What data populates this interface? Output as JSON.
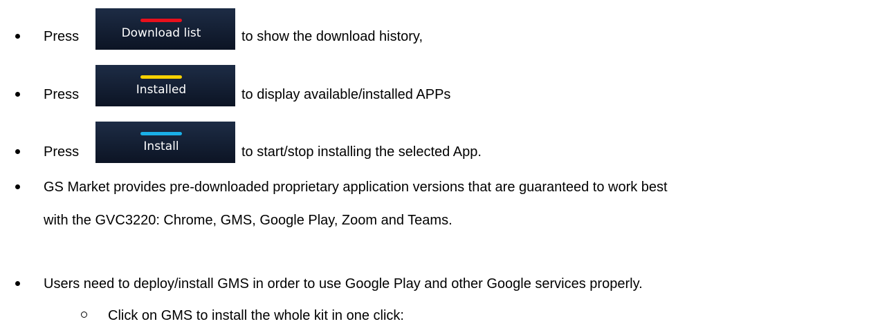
{
  "items": [
    {
      "pre": "Press",
      "button": {
        "label": "Download list",
        "accent": "#e8101c"
      },
      "post": "to show the download history,"
    },
    {
      "pre": "Press",
      "button": {
        "label": "Installed",
        "accent": "#f5d000"
      },
      "post": "to display available/installed APPs"
    },
    {
      "pre": "Press",
      "button": {
        "label": "Install",
        "accent": "#1ab0e8"
      },
      "post": "to start/stop installing the selected App."
    }
  ],
  "gs_market": {
    "line1": "GS Market provides pre-downloaded proprietary application versions that are guaranteed to work best",
    "line2": "with the GVC3220: Chrome, GMS, Google Play, Zoom and Teams."
  },
  "gms_note": "Users need to deploy/install GMS in order to use Google Play and other Google services properly.",
  "sub_item": "Click on GMS to install the whole kit in one click:"
}
